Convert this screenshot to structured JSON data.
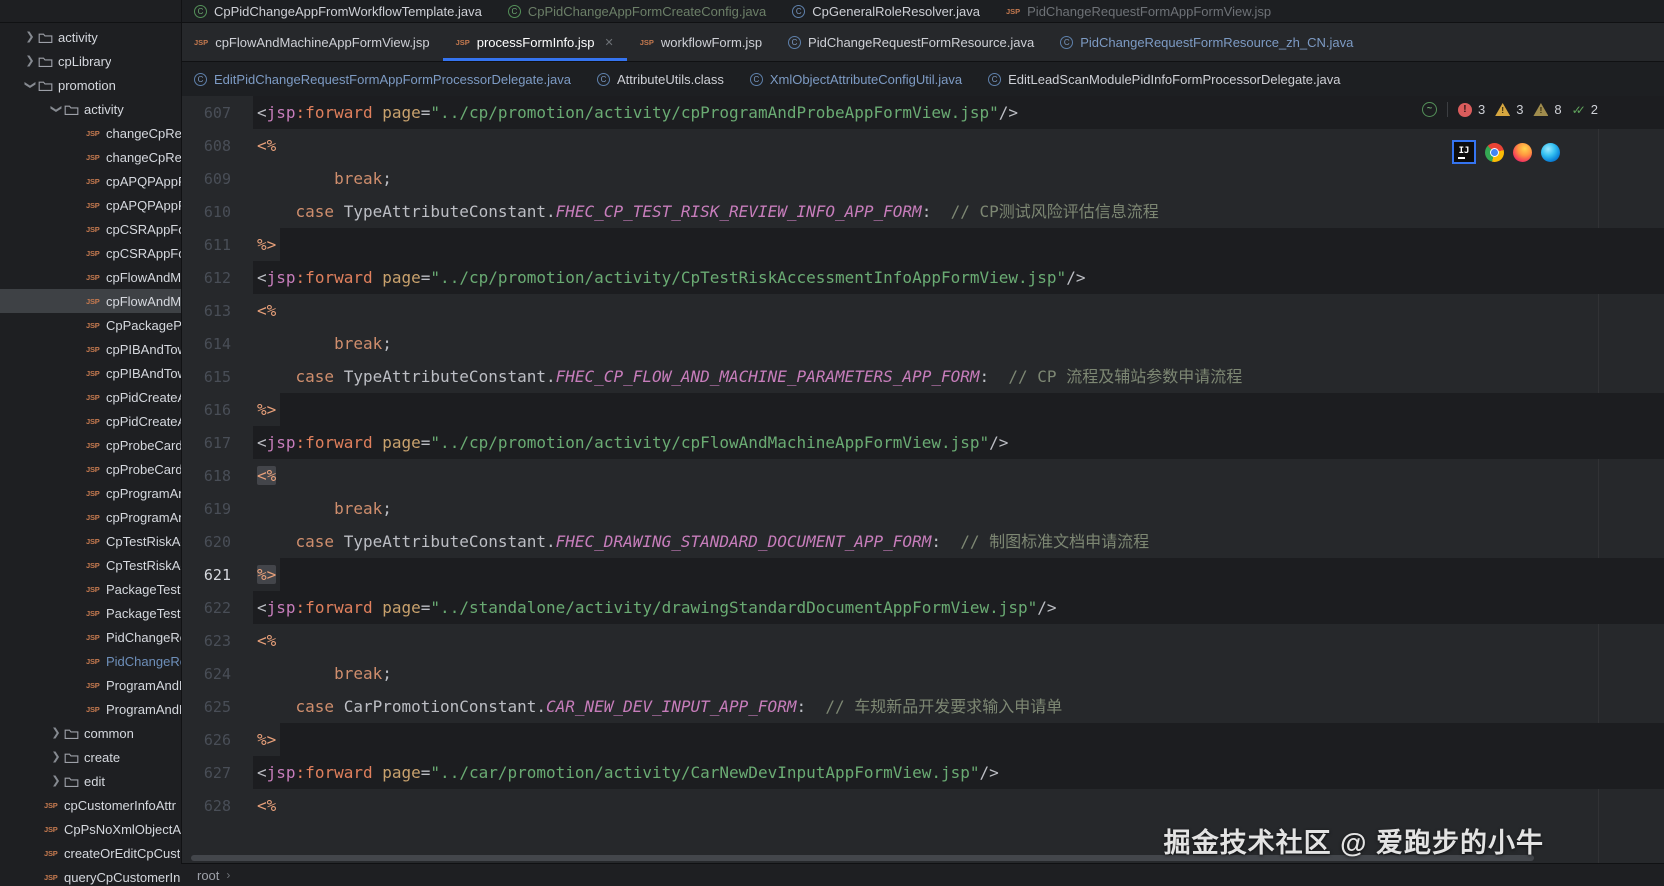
{
  "sidebar": {
    "items": [
      {
        "kind": "folder",
        "depth": 1,
        "state": "collapsed",
        "label": "activity"
      },
      {
        "kind": "folder",
        "depth": 1,
        "state": "collapsed",
        "label": "cpLibrary"
      },
      {
        "kind": "folder",
        "depth": 1,
        "state": "expanded",
        "label": "promotion"
      },
      {
        "kind": "folder",
        "depth": 2,
        "state": "expanded",
        "label": "activity"
      },
      {
        "kind": "jsp",
        "depth": 3,
        "label": "changeCpRevi"
      },
      {
        "kind": "jsp",
        "depth": 3,
        "label": "changeCpRevi"
      },
      {
        "kind": "jsp",
        "depth": 3,
        "label": "cpAPQPAppFo"
      },
      {
        "kind": "jsp",
        "depth": 3,
        "label": "cpAPQPAppFo"
      },
      {
        "kind": "jsp",
        "depth": 3,
        "label": "cpCSRAppForm"
      },
      {
        "kind": "jsp",
        "depth": 3,
        "label": "cpCSRAppForm"
      },
      {
        "kind": "jsp",
        "depth": 3,
        "label": "cpFlowAndMa"
      },
      {
        "kind": "jsp",
        "depth": 3,
        "label": "cpFlowAndMa",
        "selected": true
      },
      {
        "kind": "jsp",
        "depth": 3,
        "label": "CpPackagePar"
      },
      {
        "kind": "jsp",
        "depth": 3,
        "label": "cpPIBAndTow"
      },
      {
        "kind": "jsp",
        "depth": 3,
        "label": "cpPIBAndTow"
      },
      {
        "kind": "jsp",
        "depth": 3,
        "label": "cpPidCreateAp"
      },
      {
        "kind": "jsp",
        "depth": 3,
        "label": "cpPidCreateAp"
      },
      {
        "kind": "jsp",
        "depth": 3,
        "label": "cpProbeCardC"
      },
      {
        "kind": "jsp",
        "depth": 3,
        "label": "cpProbeCardC"
      },
      {
        "kind": "jsp",
        "depth": 3,
        "label": "cpProgramAn"
      },
      {
        "kind": "jsp",
        "depth": 3,
        "label": "cpProgramAn"
      },
      {
        "kind": "jsp",
        "depth": 3,
        "label": "CpTestRiskAcc"
      },
      {
        "kind": "jsp",
        "depth": 3,
        "label": "CpTestRiskAcc"
      },
      {
        "kind": "jsp",
        "depth": 3,
        "label": "PackageTestRe"
      },
      {
        "kind": "jsp",
        "depth": 3,
        "label": "PackageTestRe"
      },
      {
        "kind": "jsp",
        "depth": 3,
        "label": "PidChangeReq"
      },
      {
        "kind": "jsp",
        "depth": 3,
        "label": "PidChangeReq",
        "blue": true
      },
      {
        "kind": "jsp",
        "depth": 3,
        "label": "ProgramAndP"
      },
      {
        "kind": "jsp",
        "depth": 3,
        "label": "ProgramAndP"
      },
      {
        "kind": "folder",
        "depth": 2,
        "state": "collapsed",
        "label": "common"
      },
      {
        "kind": "folder",
        "depth": 2,
        "state": "collapsed",
        "label": "create"
      },
      {
        "kind": "folder",
        "depth": 2,
        "state": "collapsed",
        "label": "edit"
      },
      {
        "kind": "jsp",
        "depth": 1,
        "label": "cpCustomerInfoAttr"
      },
      {
        "kind": "jsp",
        "depth": 1,
        "label": "CpPsNoXmlObjectAt"
      },
      {
        "kind": "jsp",
        "depth": 1,
        "label": "createOrEditCpCust"
      },
      {
        "kind": "jsp",
        "depth": 1,
        "label": "queryCpCustomerIn"
      }
    ]
  },
  "tabs": {
    "rows": [
      [
        {
          "label": "CpPidChangeAppFromWorkflowTemplate.java",
          "icon": "class-green",
          "color": "normal"
        },
        {
          "label": "CpPidChangeAppFormCreateConfig.java",
          "icon": "class-green",
          "color": "dimgreen"
        },
        {
          "label": "CpGeneralRoleResolver.java",
          "icon": "class-blue",
          "color": "normal"
        },
        {
          "label": "PidChangeRequestFormAppFormView.jsp",
          "icon": "jsp",
          "color": "dim"
        }
      ],
      [
        {
          "label": "cpFlowAndMachineAppFormView.jsp",
          "icon": "jsp",
          "color": "normal"
        },
        {
          "label": "processFormInfo.jsp",
          "icon": "jsp",
          "color": "active",
          "active": true,
          "close": true
        },
        {
          "label": "workflowForm.jsp",
          "icon": "jsp",
          "color": "normal"
        },
        {
          "label": "PidChangeRequestFormResource.java",
          "icon": "class-blue",
          "color": "normal"
        },
        {
          "label": "PidChangeRequestFormResource_zh_CN.java",
          "icon": "class-blue",
          "color": "blue"
        }
      ],
      [
        {
          "label": "EditPidChangeRequestFormAppFormProcessorDelegate.java",
          "icon": "class-blue",
          "color": "blue"
        },
        {
          "label": "AttributeUtils.class",
          "icon": "class-blue",
          "color": "normal"
        },
        {
          "label": "XmlObjectAttributeConfigUtil.java",
          "icon": "class-blue",
          "color": "blue"
        },
        {
          "label": "EditLeadScanModulePidInfoFormProcessorDelegate.java",
          "icon": "class-blue",
          "color": "normal"
        }
      ]
    ]
  },
  "inspections": {
    "errors": "3",
    "warnings": "3",
    "weak_warnings": "8",
    "resolved": "2"
  },
  "browser_icons": [
    "intellij-idea",
    "chrome",
    "firefox",
    "edge"
  ],
  "editor": {
    "lines": [
      {
        "n": 607,
        "band": "full",
        "seg": [
          [
            "p",
            "<"
          ],
          [
            "ns",
            "jsp"
          ],
          [
            "tag",
            ":forward"
          ],
          [
            "w",
            " "
          ],
          [
            "at",
            "page"
          ],
          [
            "p",
            "="
          ],
          [
            "s",
            "\"../cp/promotion/activity/cpProgramAndProbeAppFormView.jsp\""
          ],
          [
            "p",
            "/>"
          ]
        ]
      },
      {
        "n": 608,
        "seg": [
          [
            "sc",
            "<%"
          ]
        ]
      },
      {
        "n": 609,
        "seg": [
          [
            "w",
            "        "
          ],
          [
            "k",
            "break"
          ],
          [
            "p",
            ";"
          ]
        ]
      },
      {
        "n": 610,
        "seg": [
          [
            "w",
            "    "
          ],
          [
            "k",
            "case"
          ],
          [
            "w",
            " "
          ],
          [
            "cl",
            "TypeAttributeConstant"
          ],
          [
            "p",
            "."
          ],
          [
            "co",
            "FHEC_CP_TEST_RISK_REVIEW_INFO_APP_FORM"
          ],
          [
            "p",
            ":"
          ],
          [
            "w",
            "  "
          ],
          [
            "cm",
            "// CP测试风险评估信息流程"
          ]
        ]
      },
      {
        "n": 611,
        "band": "after",
        "seg": [
          [
            "sc",
            "%>"
          ]
        ]
      },
      {
        "n": 612,
        "band": "full",
        "seg": [
          [
            "p",
            "<"
          ],
          [
            "ns",
            "jsp"
          ],
          [
            "tag",
            ":forward"
          ],
          [
            "w",
            " "
          ],
          [
            "at",
            "page"
          ],
          [
            "p",
            "="
          ],
          [
            "s",
            "\"../cp/promotion/activity/CpTestRiskAccessmentInfoAppFormView.jsp\""
          ],
          [
            "p",
            "/>"
          ]
        ]
      },
      {
        "n": 613,
        "seg": [
          [
            "sc",
            "<%"
          ]
        ]
      },
      {
        "n": 614,
        "seg": [
          [
            "w",
            "        "
          ],
          [
            "k",
            "break"
          ],
          [
            "p",
            ";"
          ]
        ]
      },
      {
        "n": 615,
        "seg": [
          [
            "w",
            "    "
          ],
          [
            "k",
            "case"
          ],
          [
            "w",
            " "
          ],
          [
            "cl",
            "TypeAttributeConstant"
          ],
          [
            "p",
            "."
          ],
          [
            "co",
            "FHEC_CP_FLOW_AND_MACHINE_PARAMETERS_APP_FORM"
          ],
          [
            "p",
            ":"
          ],
          [
            "w",
            "  "
          ],
          [
            "cm",
            "// CP 流程及辅站参数申请流程"
          ]
        ]
      },
      {
        "n": 616,
        "band": "after",
        "seg": [
          [
            "sc",
            "%>"
          ]
        ]
      },
      {
        "n": 617,
        "band": "full",
        "seg": [
          [
            "p",
            "<"
          ],
          [
            "ns",
            "jsp"
          ],
          [
            "tag",
            ":forward"
          ],
          [
            "w",
            " "
          ],
          [
            "at",
            "page"
          ],
          [
            "p",
            "="
          ],
          [
            "s",
            "\"../cp/promotion/activity/cpFlowAndMachineAppFormView.jsp\""
          ],
          [
            "p",
            "/>"
          ]
        ]
      },
      {
        "n": 618,
        "box": true,
        "seg": [
          [
            "sc",
            "<%"
          ]
        ]
      },
      {
        "n": 619,
        "seg": [
          [
            "w",
            "        "
          ],
          [
            "k",
            "break"
          ],
          [
            "p",
            ";"
          ]
        ]
      },
      {
        "n": 620,
        "seg": [
          [
            "w",
            "    "
          ],
          [
            "k",
            "case"
          ],
          [
            "w",
            " "
          ],
          [
            "cl",
            "TypeAttributeConstant"
          ],
          [
            "p",
            "."
          ],
          [
            "co",
            "FHEC_DRAWING_STANDARD_DOCUMENT_APP_FORM"
          ],
          [
            "p",
            ":"
          ],
          [
            "w",
            "  "
          ],
          [
            "cm",
            "// 制图标准文档申请流程"
          ]
        ]
      },
      {
        "n": 621,
        "band": "after",
        "box": true,
        "cur": true,
        "seg": [
          [
            "sc",
            "%>"
          ]
        ]
      },
      {
        "n": 622,
        "band": "full",
        "seg": [
          [
            "p",
            "<"
          ],
          [
            "ns",
            "jsp"
          ],
          [
            "tag",
            ":forward"
          ],
          [
            "w",
            " "
          ],
          [
            "at",
            "page"
          ],
          [
            "p",
            "="
          ],
          [
            "s",
            "\"../standalone/activity/drawingStandardDocumentAppFormView.jsp\""
          ],
          [
            "p",
            "/>"
          ]
        ]
      },
      {
        "n": 623,
        "seg": [
          [
            "sc",
            "<%"
          ]
        ]
      },
      {
        "n": 624,
        "seg": [
          [
            "w",
            "        "
          ],
          [
            "k",
            "break"
          ],
          [
            "p",
            ";"
          ]
        ]
      },
      {
        "n": 625,
        "seg": [
          [
            "w",
            "    "
          ],
          [
            "k",
            "case"
          ],
          [
            "w",
            " "
          ],
          [
            "cl",
            "CarPromotionConstant"
          ],
          [
            "p",
            "."
          ],
          [
            "co",
            "CAR_NEW_DEV_INPUT_APP_FORM"
          ],
          [
            "p",
            ":"
          ],
          [
            "w",
            "  "
          ],
          [
            "cm",
            "// 车规新品开发要求输入申请单"
          ]
        ]
      },
      {
        "n": 626,
        "band": "after",
        "seg": [
          [
            "sc",
            "%>"
          ]
        ]
      },
      {
        "n": 627,
        "band": "full",
        "seg": [
          [
            "p",
            "<"
          ],
          [
            "ns",
            "jsp"
          ],
          [
            "tag",
            ":forward"
          ],
          [
            "w",
            " "
          ],
          [
            "at",
            "page"
          ],
          [
            "p",
            "="
          ],
          [
            "s",
            "\"../car/promotion/activity/CarNewDevInputAppFormView.jsp\""
          ],
          [
            "p",
            "/>"
          ]
        ]
      },
      {
        "n": 628,
        "seg": [
          [
            "sc",
            "<%"
          ]
        ]
      }
    ]
  },
  "breadcrumb": {
    "label": "root"
  },
  "watermark": {
    "text": "掘金技术社区 @ 爱跑步的小牛"
  }
}
